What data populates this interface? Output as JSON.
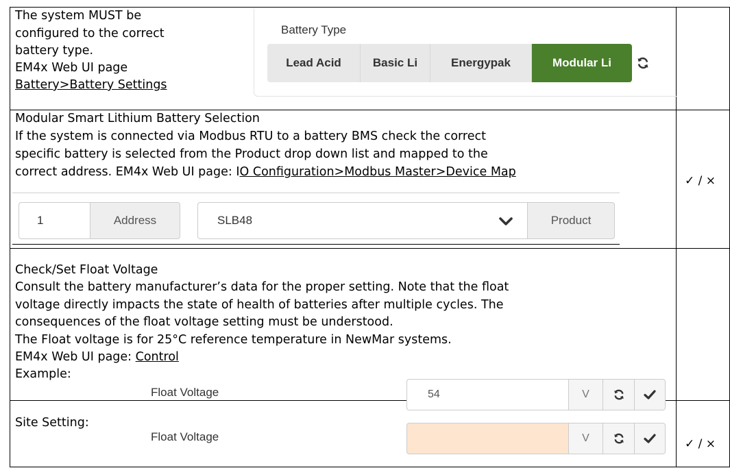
{
  "row1": {
    "lines": [
      "The system MUST be",
      "configured to the correct",
      "battery type.",
      "EM4x Web UI page"
    ],
    "link": "Battery>Battery Settings",
    "battery_type": {
      "label": "Battery Type",
      "options": [
        "Lead Acid",
        "Basic Li",
        "Energypak",
        "Modular Li"
      ],
      "selected": "Modular Li"
    }
  },
  "row2": {
    "title": "Modular Smart Lithium Battery Selection",
    "lines": [
      "If the system is connected via Modbus RTU to a battery BMS check the correct",
      "specific battery is selected from the Product drop down list and mapped to the"
    ],
    "line3_prefix": "correct address. EM4x Web UI page: I",
    "line3_link": "O Configuration>Modbus Master>Device Map",
    "address_value": "1",
    "address_label": "Address",
    "product_value": "SLB48",
    "product_label": "Product",
    "check_mark": "✓ / ×"
  },
  "row3": {
    "lines": [
      "Check/Set Float Voltage",
      "Consult the battery manufacturer’s data for the proper setting. Note that the float",
      "voltage directly impacts the state of health of batteries after multiple cycles. The",
      "consequences of the float voltage setting must be understood.",
      "The Float voltage is for 25°C reference temperature in NewMar systems."
    ],
    "page_prefix": "EM4x Web UI page: ",
    "page_link": "Control",
    "example_label": "Example:",
    "field_label": "Float Voltage",
    "field_value": "54",
    "unit": "V"
  },
  "row4": {
    "site_label": "Site Setting:",
    "field_label": "Float Voltage",
    "field_value": "",
    "unit": "V",
    "input_bg": "#fde5cf",
    "check_mark": "✓ / ×"
  },
  "colors": {
    "selected_green": "#4a7f2c",
    "button_gray": "#e8e8e8"
  }
}
